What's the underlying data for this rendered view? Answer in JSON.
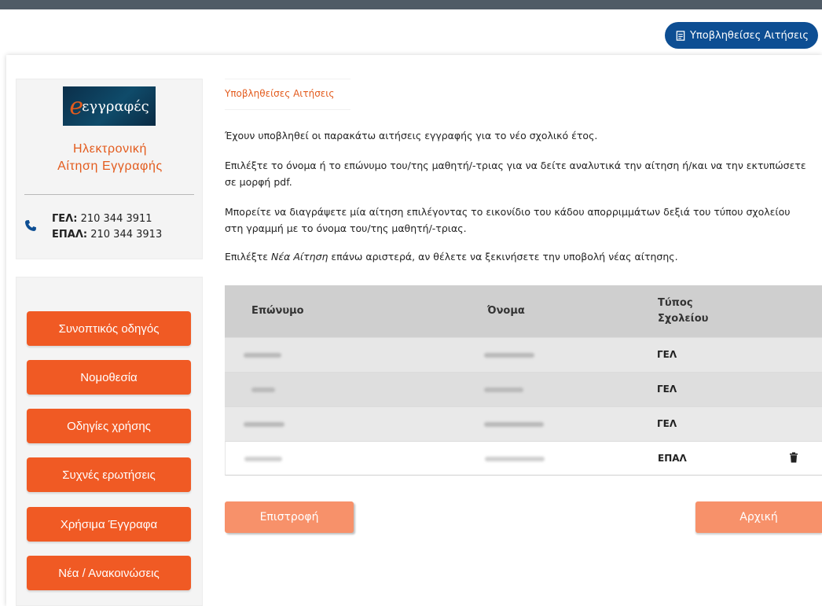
{
  "header": {
    "submitted_button_label": "Υποβληθείσες Αιτήσεις"
  },
  "sidebar": {
    "logo_text": "εγγραφές",
    "app_title_line1": "Ηλεκτρονική",
    "app_title_line2": "Αίτηση Εγγραφής",
    "phones": [
      {
        "label": "ΓΕΛ:",
        "number": "210 344 3911"
      },
      {
        "label": "ΕΠΑΛ:",
        "number": "210 344 3913"
      }
    ],
    "nav": [
      {
        "label": "Συνοπτικός οδηγός"
      },
      {
        "label": "Νομοθεσία"
      },
      {
        "label": "Οδηγίες χρήσης"
      },
      {
        "label": "Συχνές ερωτήσεις"
      },
      {
        "label": "Χρήσιμα Έγγραφα"
      },
      {
        "label": "Νέα / Ανακοινώσεις"
      }
    ]
  },
  "main": {
    "breadcrumb": "Υποβληθείσες Αιτήσεις",
    "paragraphs": {
      "p1": "Έχουν υποβληθεί οι παρακάτω αιτήσεις εγγραφής για το νέο σχολικό έτος.",
      "p2": "Επιλέξτε το όνομα ή το επώνυμο του/της μαθητή/-τριας για να δείτε αναλυτικά την αίτηση ή/και να την εκτυπώσετε σε μορφή pdf.",
      "p3": "Μπορείτε να διαγράψετε μία αίτηση επιλέγοντας το εικονίδιο του κάδου απορριμμάτων δεξιά του τύπου σχολείου στη γραμμή με το όνομα του/της μαθητή/-τριας.",
      "p4_before": "Επιλέξτε ",
      "p4_italic": "Νέα Αίτηση",
      "p4_after": " επάνω αριστερά, αν θέλετε να ξεκινήσετε την υποβολή νέας αίτησης."
    },
    "table": {
      "headers": {
        "surname": "Επώνυμο",
        "name": "Όνομα",
        "type_line1": "Τύπος",
        "type_line2": "Σχολείου"
      },
      "rows": [
        {
          "type": "ΓΕΛ"
        },
        {
          "type": "ΓΕΛ"
        },
        {
          "type": "ΓΕΛ"
        },
        {
          "type": "ΕΠΑΛ"
        }
      ]
    },
    "buttons": {
      "back": "Επιστροφή",
      "home": "Αρχική"
    }
  },
  "colors": {
    "accent": "#f05a24",
    "primary": "#0d4e93",
    "soft_button": "#f7916a"
  },
  "icons": [
    "file-text-icon",
    "phone-icon",
    "trash-icon"
  ]
}
